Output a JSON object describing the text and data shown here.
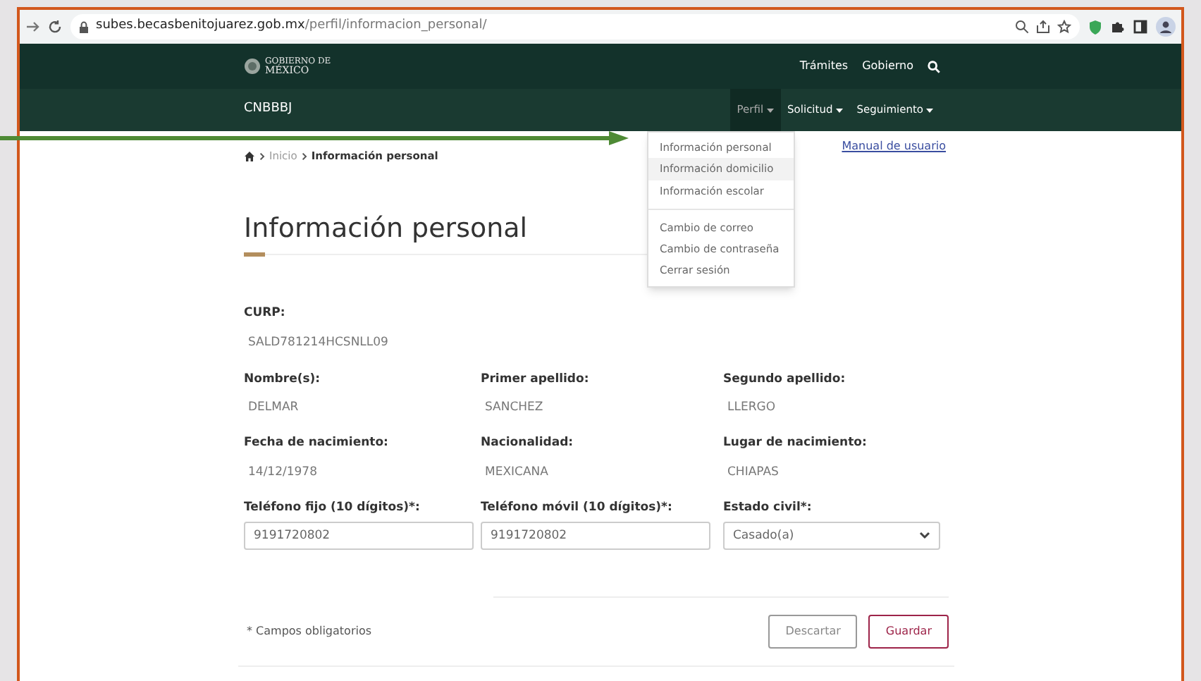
{
  "browser": {
    "url_host": "subes.becasbenitojuarez.gob.mx",
    "url_path": "/perfil/informacion_personal/"
  },
  "header": {
    "logo_lines": [
      "GOBIERNO DE",
      "MÉXICO"
    ],
    "links": [
      "Trámites",
      "Gobierno"
    ]
  },
  "nav": {
    "brand": "CNBBBJ",
    "items": [
      {
        "label": "Perfil",
        "selected": true
      },
      {
        "label": "Solicitud",
        "selected": false
      },
      {
        "label": "Seguimiento",
        "selected": false
      }
    ]
  },
  "dropdown": {
    "groups": [
      [
        {
          "label": "Información personal",
          "selected": false
        },
        {
          "label": "Información domicilio",
          "selected": true
        },
        {
          "label": "Información escolar",
          "selected": false
        }
      ],
      [
        {
          "label": "Cambio de correo",
          "selected": false
        },
        {
          "label": "Cambio de contraseña",
          "selected": false
        },
        {
          "label": "Cerrar sesión",
          "selected": false
        }
      ]
    ]
  },
  "breadcrumb": [
    "Inicio",
    "Información personal"
  ],
  "manual_link": "Manual de usuario",
  "title": "Información personal",
  "curp": {
    "label": "CURP:",
    "value": "SALD781214HCSNLL09"
  },
  "fields": [
    {
      "label": "Nombre(s):",
      "value": "DELMAR",
      "kind": "text"
    },
    {
      "label": "Primer apellido:",
      "value": "SANCHEZ",
      "kind": "text"
    },
    {
      "label": "Segundo apellido:",
      "value": "LLERGO",
      "kind": "text"
    },
    {
      "label": "Fecha de nacimiento:",
      "value": "14/12/1978",
      "kind": "text"
    },
    {
      "label": "Nacionalidad:",
      "value": "MEXICANA",
      "kind": "text"
    },
    {
      "label": "Lugar de nacimiento:",
      "value": "CHIAPAS",
      "kind": "text"
    },
    {
      "label": "Teléfono fijo (10 dígitos)*:",
      "value": "9191720802",
      "kind": "input"
    },
    {
      "label": "Teléfono móvil (10 dígitos)*:",
      "value": "9191720802",
      "kind": "input"
    },
    {
      "label": "Estado civil*:",
      "value": "Casado(a)",
      "kind": "select"
    }
  ],
  "note": "* Campos obligatorios",
  "buttons": [
    {
      "label": "Descartar",
      "kind": "secondary"
    },
    {
      "label": "Guardar",
      "kind": "primary"
    }
  ]
}
